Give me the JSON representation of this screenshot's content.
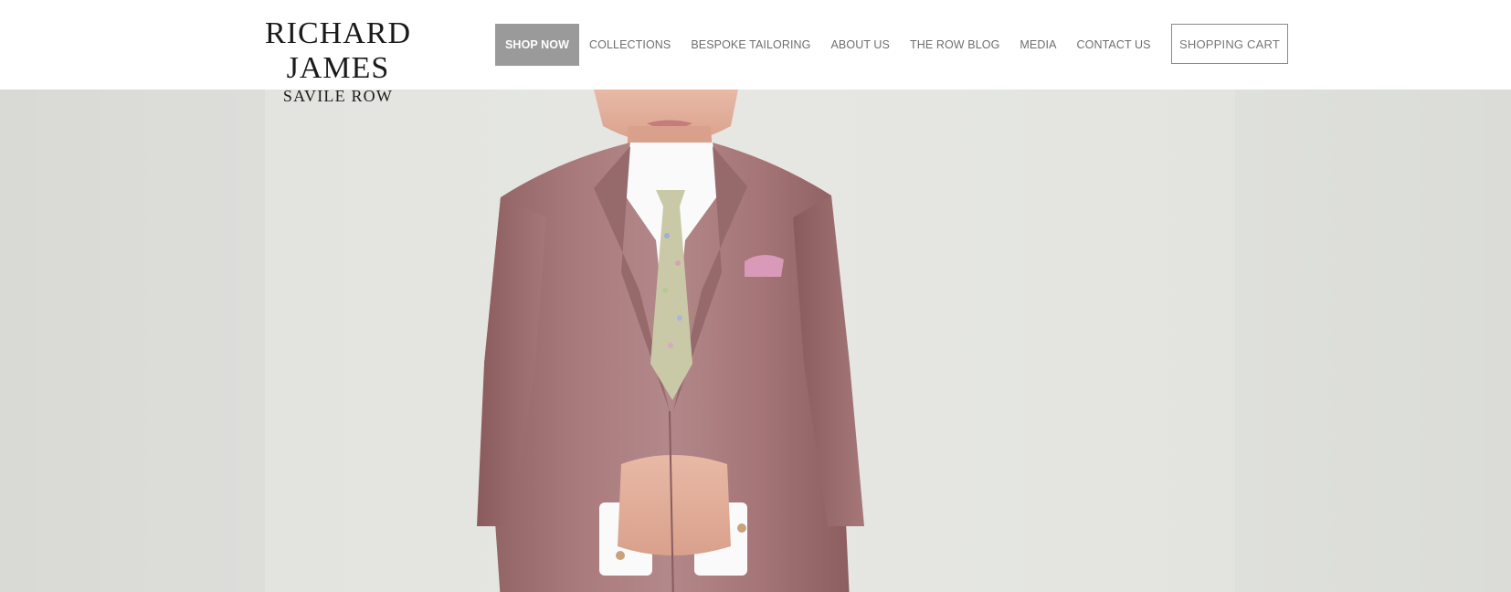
{
  "brand": {
    "name": "RICHARD JAMES",
    "tagline": "SAVILE ROW"
  },
  "nav": {
    "items": [
      {
        "label": "SHOP NOW",
        "active": true
      },
      {
        "label": "COLLECTIONS",
        "active": false
      },
      {
        "label": "BESPOKE TAILORING",
        "active": false
      },
      {
        "label": "ABOUT US",
        "active": false
      },
      {
        "label": "THE ROW BLOG",
        "active": false
      },
      {
        "label": "MEDIA",
        "active": false
      },
      {
        "label": "CONTACT US",
        "active": false
      }
    ]
  },
  "cart": {
    "label": "SHOPPING CART"
  },
  "colors": {
    "nav_active_bg": "#9a9a9a",
    "nav_text": "#6e6e6e",
    "hero_background": "#e4e4e0",
    "jacket": "#a97a7c",
    "tie": "#c9c9a8",
    "pocket_square": "#d89ab8"
  },
  "hero": {
    "image_subject": "model-in-pink-suit"
  }
}
